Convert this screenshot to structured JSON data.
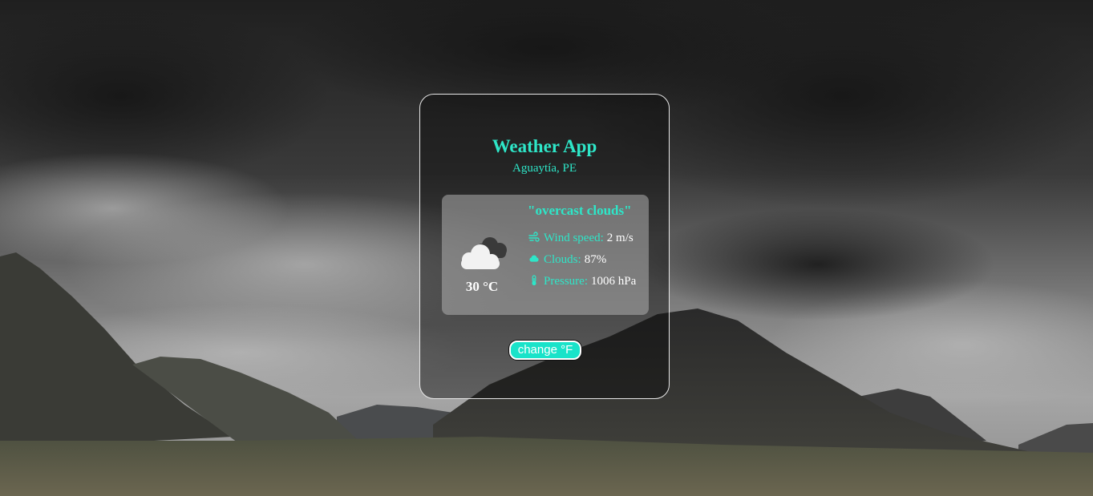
{
  "app": {
    "title": "Weather App",
    "location": "Aguaytía, PE"
  },
  "weather": {
    "description": "\"overcast clouds\"",
    "temperature": "30 °C",
    "icon": "overcast-clouds-icon",
    "stats": [
      {
        "icon": "wind-icon",
        "label": "Wind speed:",
        "value": "2 m/s"
      },
      {
        "icon": "cloud-icon",
        "label": "Clouds:",
        "value": "87%"
      },
      {
        "icon": "thermometer-icon",
        "label": "Pressure:",
        "value": "1006 hPa"
      }
    ]
  },
  "controls": {
    "toggle_unit_label": "change °F"
  },
  "colors": {
    "accent": "#2ee6c8",
    "button_bg": "#19e3c9",
    "text_light": "#ffffff"
  }
}
